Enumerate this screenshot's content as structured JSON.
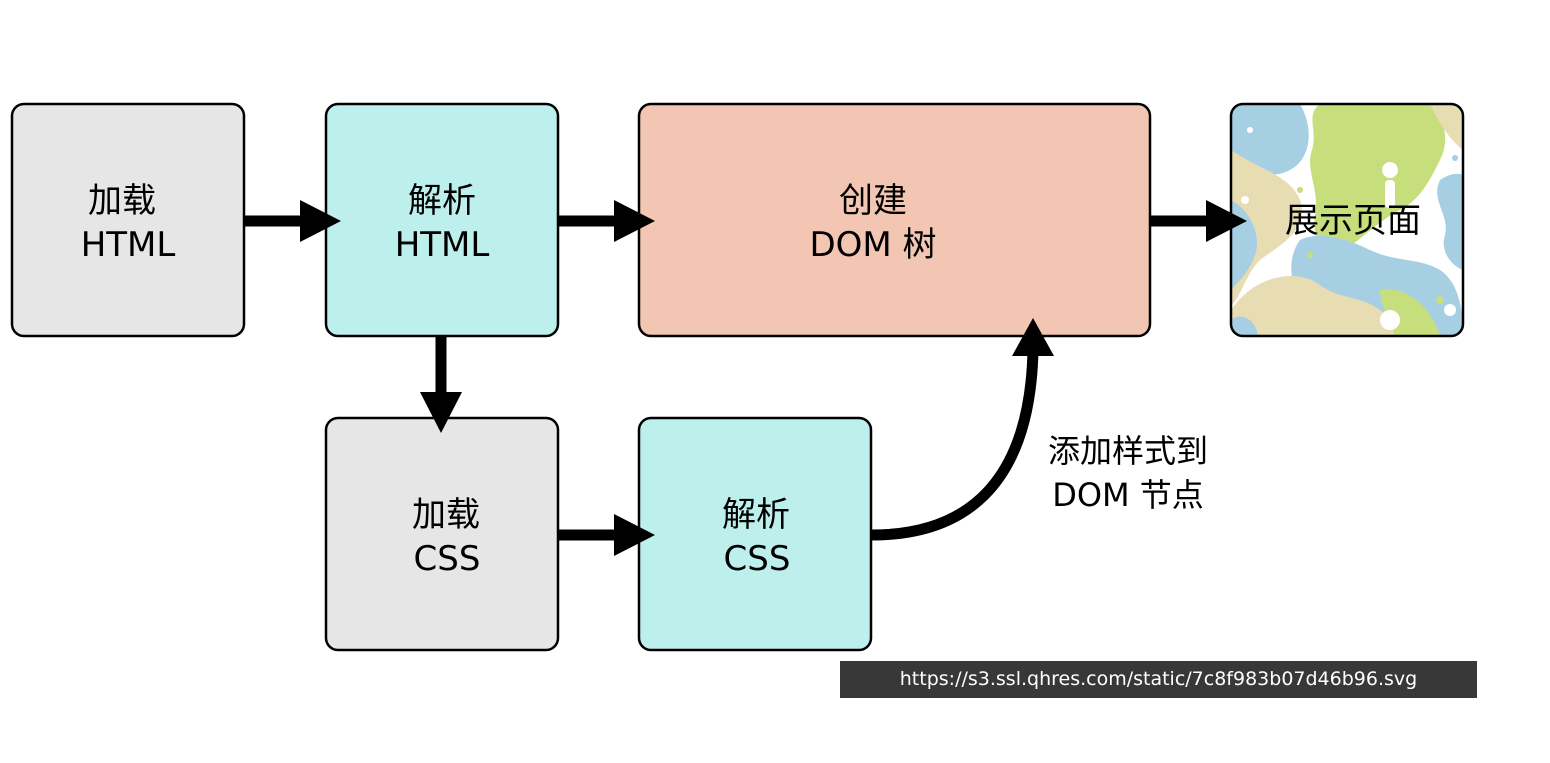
{
  "nodes": {
    "load_html": {
      "line1": "加载",
      "line2": "HTML"
    },
    "parse_html": {
      "line1": "解析",
      "line2": "HTML"
    },
    "create_dom": {
      "line1": "创建",
      "line2": "DOM 树"
    },
    "show_page": {
      "line1": "展示页面"
    },
    "load_css": {
      "line1": "加载",
      "line2": "CSS"
    },
    "parse_css": {
      "line1": "解析",
      "line2": "CSS"
    }
  },
  "edges": {
    "style_to_dom": {
      "line1": "添加样式到",
      "line2": "DOM 节点"
    }
  },
  "source_url": "https://s3.ssl.qhres.com/static/7c8f983b07d46b96.svg",
  "colors": {
    "gray_box": "#e6e6e6",
    "cyan_box": "#bdefec",
    "salmon_box": "#f2c6b2",
    "stroke": "#000000",
    "pattern_blue": "#a7cfe3",
    "pattern_green": "#c6de7c",
    "pattern_beige": "#e8dcb3"
  }
}
